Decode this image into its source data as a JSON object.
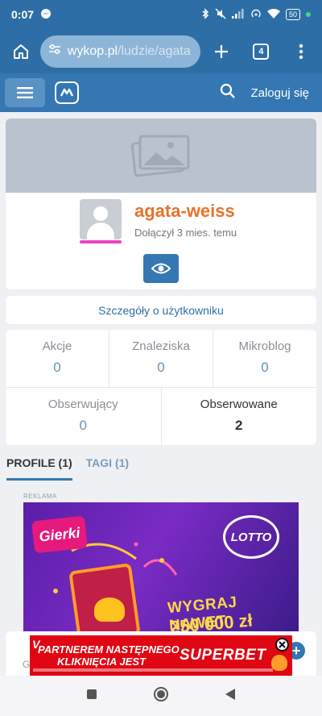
{
  "status_bar": {
    "time": "0:07",
    "battery": "50"
  },
  "browser": {
    "url_host": "wykop.pl",
    "url_path": "/ludzie/agata",
    "tabs_count": "4"
  },
  "site_header": {
    "login_label": "Zaloguj się"
  },
  "profile": {
    "username": "agata-weiss",
    "joined": "Dołączył 3 mies. temu",
    "details_label": "Szczegóły o użytkowniku"
  },
  "stats": {
    "row1": [
      {
        "label": "Akcje",
        "value": "0"
      },
      {
        "label": "Znaleziska",
        "value": "0"
      },
      {
        "label": "Mikroblog",
        "value": "0"
      }
    ],
    "row2": [
      {
        "label": "Obserwujący",
        "value": "0"
      },
      {
        "label": "Obserwowane",
        "value": "2"
      }
    ]
  },
  "tabs": [
    {
      "label": "PROFILE (1)"
    },
    {
      "label": "TAGI (1)"
    }
  ],
  "ad": {
    "label": "REKLAMA",
    "brand_left": "Gierki",
    "brand_right": "LOTTO",
    "headline": "WYGRAJ NAWET",
    "amount": "250 000 zł"
  },
  "bottom_ad": {
    "line1": "PARTNEREM NASTĘPNEGO",
    "line2": "KLIKNIĘCIA JEST",
    "brand": "SUPERBET"
  },
  "strip": {
    "letter": "G",
    "plus": "+"
  },
  "colors": {
    "header_blue": "#2e6ea6",
    "accent_orange": "#e8722a",
    "avatar_underline": "#e847c1"
  }
}
